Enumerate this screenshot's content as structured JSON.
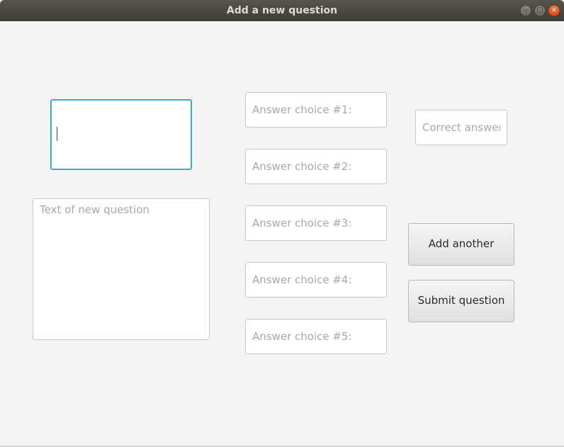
{
  "window": {
    "title": "Add a new question"
  },
  "question": {
    "input_value": "",
    "text_placeholder": "Text of new question"
  },
  "answers": [
    {
      "placeholder": "Answer choice #1:"
    },
    {
      "placeholder": "Answer choice #2:"
    },
    {
      "placeholder": "Answer choice #3:"
    },
    {
      "placeholder": "Answer choice #4:"
    },
    {
      "placeholder": "Answer choice #5:"
    }
  ],
  "correct_answer": {
    "placeholder": "Correct answer"
  },
  "buttons": {
    "add_another": "Add another",
    "submit": "Submit question"
  },
  "colors": {
    "focus_border": "#2ea6d6",
    "titlebar": "#3f3d39",
    "close_button": "#df4a16"
  }
}
